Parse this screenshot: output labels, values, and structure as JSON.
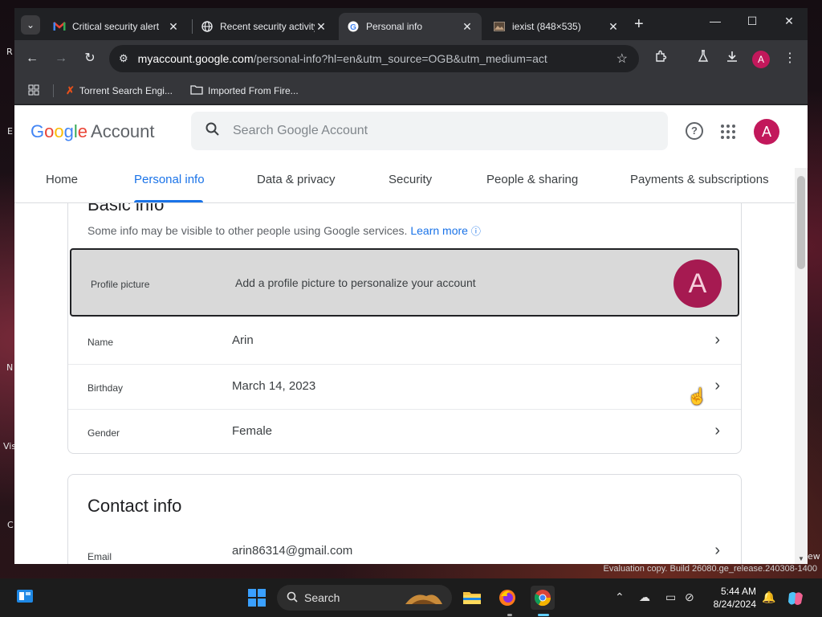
{
  "desktop": {
    "edge_letters": [
      "R",
      "E",
      "N",
      "Vis",
      "C"
    ],
    "watermark": "Evaluation copy. Build 26080.ge_release.240308-1400",
    "watermark_suffix": "ew"
  },
  "browser": {
    "tabs": [
      {
        "title": "Critical security alert",
        "icon": "gmail-icon"
      },
      {
        "title": "Recent security activity",
        "icon": "globe-icon"
      },
      {
        "title": "Personal info",
        "icon": "google-g-icon",
        "active": true
      },
      {
        "title": "iexist (848×535)",
        "icon": "image-icon"
      }
    ],
    "url_host": "myaccount.google.com",
    "url_path": "/personal-info?hl=en&utm_source=OGB&utm_medium=act",
    "profile_initial": "A",
    "bookmarks": [
      {
        "label": "Torrent Search Engi...",
        "icon": "x-icon"
      },
      {
        "label": "Imported From Fire...",
        "icon": "folder-icon"
      }
    ]
  },
  "account": {
    "logo_google": [
      "G",
      "o",
      "o",
      "g",
      "l",
      "e"
    ],
    "logo_colors": [
      "#4285F4",
      "#EA4335",
      "#FBBC05",
      "#4285F4",
      "#34A853",
      "#EA4335"
    ],
    "logo_account": "Account",
    "search_placeholder": "Search Google Account",
    "avatar_initial": "A",
    "nav": [
      "Home",
      "Personal info",
      "Data & privacy",
      "Security",
      "People & sharing",
      "Payments & subscriptions"
    ],
    "active_nav": "Personal info"
  },
  "basic_info": {
    "title": "Basic info",
    "subtitle": "Some info may be visible to other people using Google services.",
    "learn_more": "Learn more",
    "profile_label": "Profile picture",
    "profile_text": "Add a profile picture to personalize your account",
    "profile_initial": "A",
    "rows": [
      {
        "label": "Name",
        "value": "Arin"
      },
      {
        "label": "Birthday",
        "value": "March 14, 2023"
      },
      {
        "label": "Gender",
        "value": "Female"
      }
    ]
  },
  "contact_info": {
    "title": "Contact info",
    "rows": [
      {
        "label": "Email",
        "value": "arin86314@gmail.com"
      }
    ]
  },
  "taskbar": {
    "search_label": "Search",
    "time": "5:44 AM",
    "date": "8/24/2024",
    "apps": [
      "file-explorer-icon",
      "firefox-icon",
      "chrome-icon"
    ]
  }
}
